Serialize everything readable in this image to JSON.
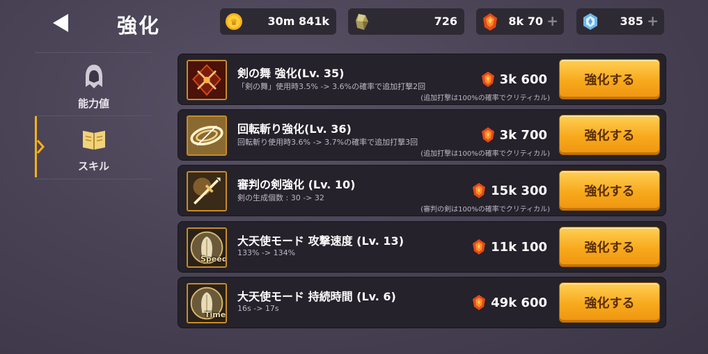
{
  "header": {
    "title": "強化"
  },
  "currencies": [
    {
      "icon": "gold-coin-icon",
      "value": "30m 841k",
      "has_plus": false
    },
    {
      "icon": "ore-stone-icon",
      "value": "726",
      "has_plus": false
    },
    {
      "icon": "red-gem-icon",
      "value": "8k 70",
      "has_plus": true
    },
    {
      "icon": "blue-crystal-icon",
      "value": "385",
      "has_plus": true
    }
  ],
  "sidebar": {
    "items": [
      {
        "label": "能力値",
        "icon": "hooded-figure-icon",
        "active": false
      },
      {
        "label": "スキル",
        "icon": "open-book-icon",
        "active": true
      }
    ]
  },
  "skills": [
    {
      "title": "剣の舞 強化(Lv. 35)",
      "desc": "「剣の舞」使用時3.5% -> 3.6%の確率で追加打撃2回",
      "note": "(追加打撃は100%の確率でクリティカル)",
      "cost": "3k 600",
      "button": "強化する",
      "icon": "sword-dance-icon",
      "tag": ""
    },
    {
      "title": "回転斬り強化(Lv. 36)",
      "desc": "回転斬り使用時3.6% -> 3.7%の確率で追加打撃3回",
      "note": "(追加打撃は100%の確率でクリティカル)",
      "cost": "3k 700",
      "button": "強化する",
      "icon": "spin-slash-icon",
      "tag": ""
    },
    {
      "title": "審判の剣強化 (Lv. 10)",
      "desc": "剣の生成個数 : 30 -> 32",
      "note": "(審判の剣は100%の確率でクリティカル)",
      "cost": "15k 300",
      "button": "強化する",
      "icon": "judgment-sword-icon",
      "tag": ""
    },
    {
      "title": "大天使モード 攻撃速度 (Lv. 13)",
      "desc": "133% -> 134%",
      "note": "",
      "cost": "11k 100",
      "button": "強化する",
      "icon": "archangel-wing-icon",
      "tag": "Speed"
    },
    {
      "title": "大天使モード 持続時間 (Lv. 6)",
      "desc": "16s -> 17s",
      "note": "",
      "cost": "49k 600",
      "button": "強化する",
      "icon": "archangel-wing-icon",
      "tag": "Time"
    }
  ],
  "colors": {
    "accent_gold": "#f7a91c",
    "panel": "#25222b",
    "background": "#4a4356",
    "gem_red": "#e24a1a"
  }
}
